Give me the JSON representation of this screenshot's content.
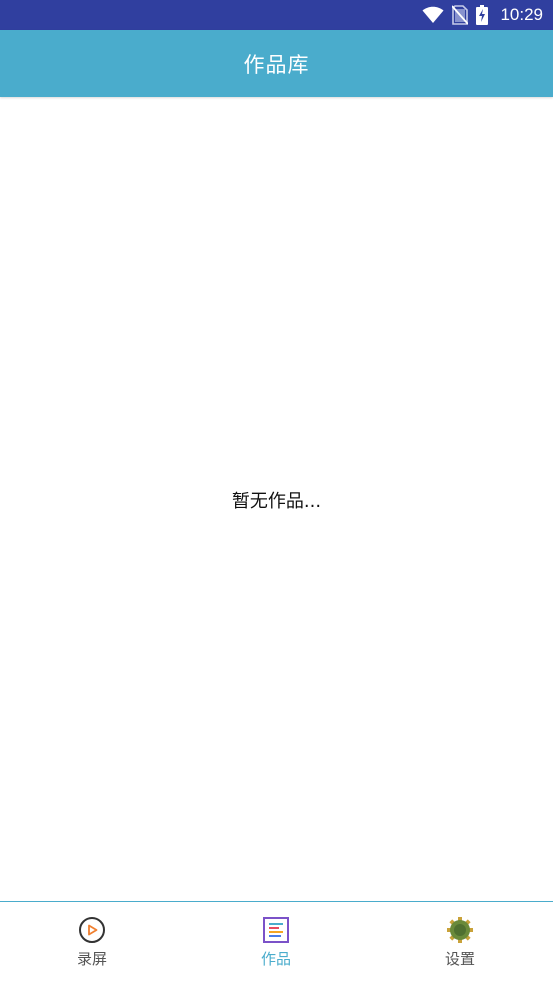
{
  "status_bar": {
    "time": "10:29",
    "icons": [
      "wifi-icon",
      "no-sim-icon",
      "battery-charging-icon"
    ]
  },
  "app_bar": {
    "title": "作品库"
  },
  "content": {
    "empty_message": "暂无作品..."
  },
  "bottom_nav": {
    "active_index": 1,
    "items": [
      {
        "label": "录屏",
        "icon": "record-play-icon"
      },
      {
        "label": "作品",
        "icon": "works-list-icon"
      },
      {
        "label": "设置",
        "icon": "settings-gear-icon"
      }
    ]
  },
  "colors": {
    "status_bar": "#303f9f",
    "app_bar": "#4aaccc",
    "active_tab": "#4aaccc",
    "inactive_tab": "#555555"
  }
}
